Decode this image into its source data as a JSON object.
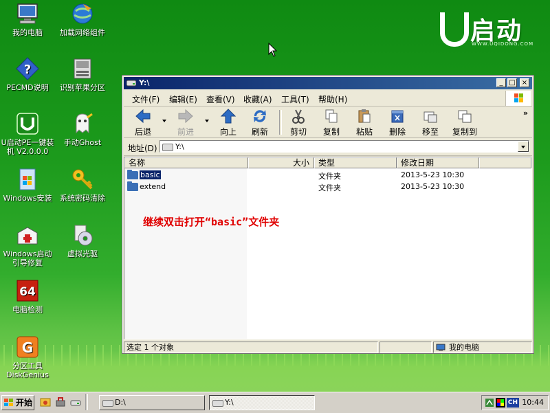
{
  "desktop": {
    "icons": [
      {
        "label": "我的电脑",
        "icon": "my-computer-icon"
      },
      {
        "label": "加载网络组件",
        "icon": "network-loader-icon"
      },
      {
        "label": "PECMD说明",
        "icon": "help-icon"
      },
      {
        "label": "识别苹果分区",
        "icon": "disk-icon"
      },
      {
        "label": "U启动PE一键装机 V2.0.0.0",
        "icon": "installer-icon"
      },
      {
        "label": "手动Ghost",
        "icon": "ghost-icon"
      },
      {
        "label": "Windows安装",
        "icon": "windows-setup-icon"
      },
      {
        "label": "系统密码清除",
        "icon": "key-icon"
      },
      {
        "label": "Windows启动引导修复",
        "icon": "toolbox-icon"
      },
      {
        "label": "虚拟光驱",
        "icon": "virtual-cd-icon"
      },
      {
        "label": "电脑检测",
        "icon": "aida64-icon"
      },
      {
        "label": "分区工具 DiskGenius",
        "icon": "diskgenius-icon"
      }
    ],
    "logo": {
      "text": "启动",
      "url": "WWW.UQIDONG.COM"
    }
  },
  "window": {
    "title": "Y:\\",
    "menu": [
      "文件(F)",
      "编辑(E)",
      "查看(V)",
      "收藏(A)",
      "工具(T)",
      "帮助(H)"
    ],
    "toolbar": {
      "back": "后退",
      "forward": "前进",
      "up": "向上",
      "refresh": "刷新",
      "cut": "剪切",
      "copy": "复制",
      "paste": "粘贴",
      "delete": "删除",
      "move": "移至",
      "copy_to": "复制到"
    },
    "address": {
      "label": "地址(D)",
      "value": "Y:\\"
    },
    "columns": [
      "名称",
      "大小",
      "类型",
      "修改日期"
    ],
    "rows": [
      {
        "name": "basic",
        "size": "",
        "type": "文件夹",
        "date": "2013-5-23 10:30"
      },
      {
        "name": "extend",
        "size": "",
        "type": "文件夹",
        "date": "2013-5-23 10:30"
      }
    ],
    "annotation": "继续双击打开“basic”文件夹",
    "status": {
      "selection": "选定 1 个对象",
      "location": "我的电脑"
    }
  },
  "taskbar": {
    "start": "开始",
    "tasks": [
      "D:\\",
      "Y:\\"
    ],
    "ime": "CH",
    "clock": "10:44"
  },
  "colors": {
    "accent": "#0a246a",
    "desktop": "#1c9a1c",
    "annotation": "#e00000"
  }
}
